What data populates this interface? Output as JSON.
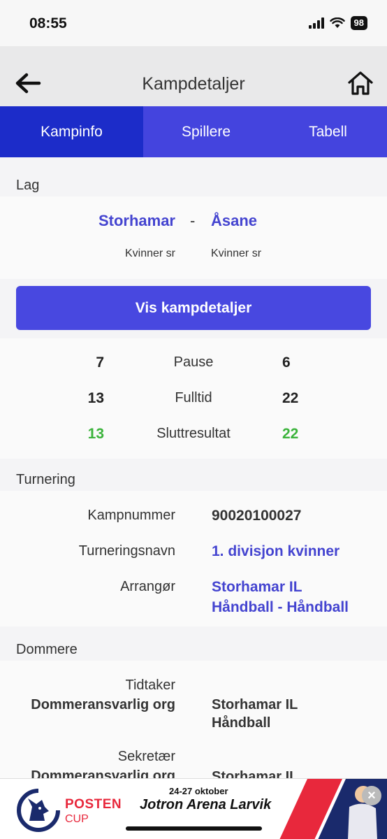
{
  "status": {
    "time": "08:55",
    "battery": "98"
  },
  "header": {
    "title": "Kampdetaljer",
    "back_icon": "arrow-left-icon",
    "home_icon": "home-icon"
  },
  "tabs": [
    {
      "label": "Kampinfo",
      "active": true
    },
    {
      "label": "Spillere",
      "active": false
    },
    {
      "label": "Tabell",
      "active": false
    }
  ],
  "teams_section": {
    "label": "Lag",
    "home_team": "Storhamar",
    "separator": "-",
    "away_team": "Åsane",
    "home_class": "Kvinner sr",
    "away_class": "Kvinner sr"
  },
  "details_button": "Vis kampdetaljer",
  "scores": [
    {
      "home": "7",
      "label": "Pause",
      "away": "6",
      "highlight": false
    },
    {
      "home": "13",
      "label": "Fulltid",
      "away": "22",
      "highlight": false
    },
    {
      "home": "13",
      "label": "Sluttresultat",
      "away": "22",
      "highlight": true
    }
  ],
  "tournament_section": {
    "label": "Turnering",
    "match_number_label": "Kampnummer",
    "match_number": "90020100027",
    "tournament_name_label": "Turneringsnavn",
    "tournament_name": "1. divisjon kvinner",
    "organizer_label": "Arrangør",
    "organizer_line1": "Storhamar IL",
    "organizer_line2": "Håndball - Håndball"
  },
  "referees_section": {
    "label": "Dommere",
    "timekeeper_role": "Tidtaker",
    "timekeeper_org_label": "Dommeransvarlig org",
    "timekeeper_org_line1": "Storhamar IL",
    "timekeeper_org_line2": "Håndball",
    "secretary_role": "Sekretær",
    "secretary_org_label": "Dommeransvarlig org",
    "secretary_org_line1": "Storhamar IL"
  },
  "ad": {
    "brand": "POSTEN",
    "cup": "CUP",
    "date": "24-27 oktober",
    "venue": "Jotron Arena Larvik",
    "close_icon": "close-icon"
  },
  "colors": {
    "accent": "#4444de",
    "active_tab": "#1c2cc9",
    "link": "#4444d0",
    "result_green": "#3bb33b"
  }
}
